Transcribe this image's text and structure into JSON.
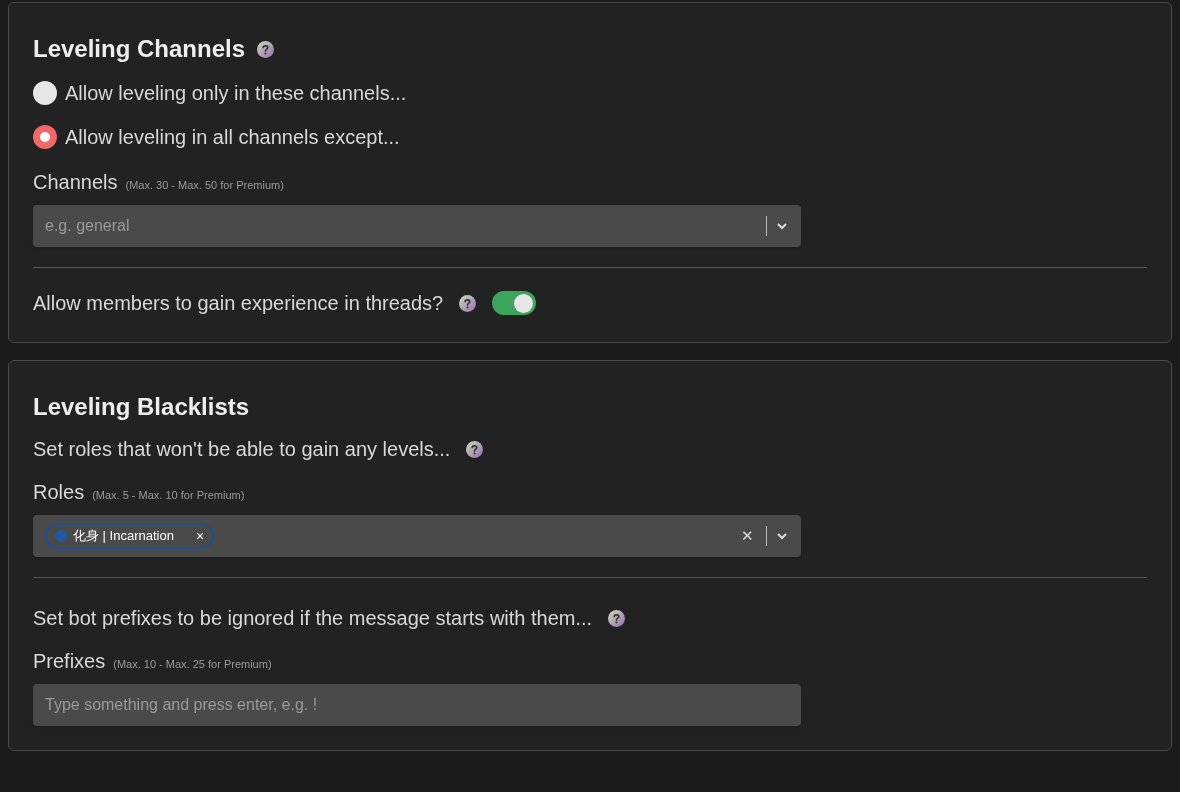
{
  "sections": [
    {
      "title": "Leveling Channels",
      "help": true,
      "items": [
        {
          "kind": "radio",
          "label": "Allow leveling only in these channels...",
          "selected": false
        },
        {
          "kind": "radio",
          "label": "Allow leveling in all channels except...",
          "selected": true
        },
        {
          "kind": "label",
          "label": "Channels",
          "note": "(Max. 30 - Max. 50 for Premium)"
        },
        {
          "kind": "select",
          "placeholder": "e.g. general"
        },
        {
          "kind": "divider"
        },
        {
          "kind": "toggle",
          "label": "Allow members to gain experience in threads?",
          "help": true,
          "on": true
        }
      ]
    },
    {
      "title": "Leveling Blacklists",
      "help": false,
      "items": [
        {
          "kind": "text",
          "label": "Set roles that won't be able to gain any levels...",
          "help": true
        },
        {
          "kind": "label",
          "label": "Roles",
          "note": "(Max. 5 - Max. 10 for Premium)"
        },
        {
          "kind": "select",
          "tags": [
            {
              "label": "化身 | Incarnation",
              "color": "#1f5aa6",
              "remove": "×"
            }
          ],
          "clear": "✕"
        },
        {
          "kind": "divider"
        },
        {
          "kind": "text",
          "label": "Set bot prefixes to be ignored if the message starts with them...",
          "help": true
        },
        {
          "kind": "label",
          "label": "Prefixes",
          "note": "(Max. 10 - Max. 25 for Premium)"
        },
        {
          "kind": "input",
          "placeholder": "Type something and press enter, e.g. !"
        }
      ]
    }
  ]
}
